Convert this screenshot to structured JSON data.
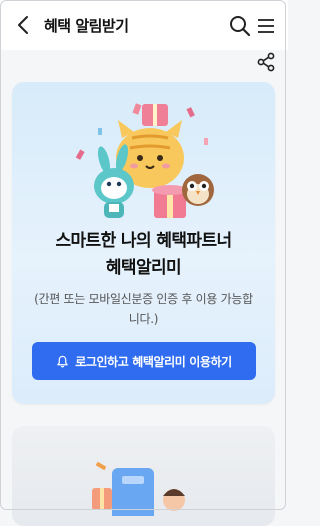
{
  "header": {
    "title": "혜택 알림받기",
    "back_icon": "chevron-left-icon",
    "search_icon": "search-icon",
    "menu_icon": "hamburger-menu-icon",
    "share_icon": "share-icon"
  },
  "promo": {
    "headline_line1": "스마트한 나의 혜택파트너",
    "headline_line2": "혜택알리미",
    "subtext": "(간편 또는 모바일신분증 인증 후 이용 가능합니다.)",
    "cta_label": "로그인하고 혜택알리미 이용하기",
    "cta_icon": "bell-icon",
    "accent_color": "#2f6cf0"
  }
}
